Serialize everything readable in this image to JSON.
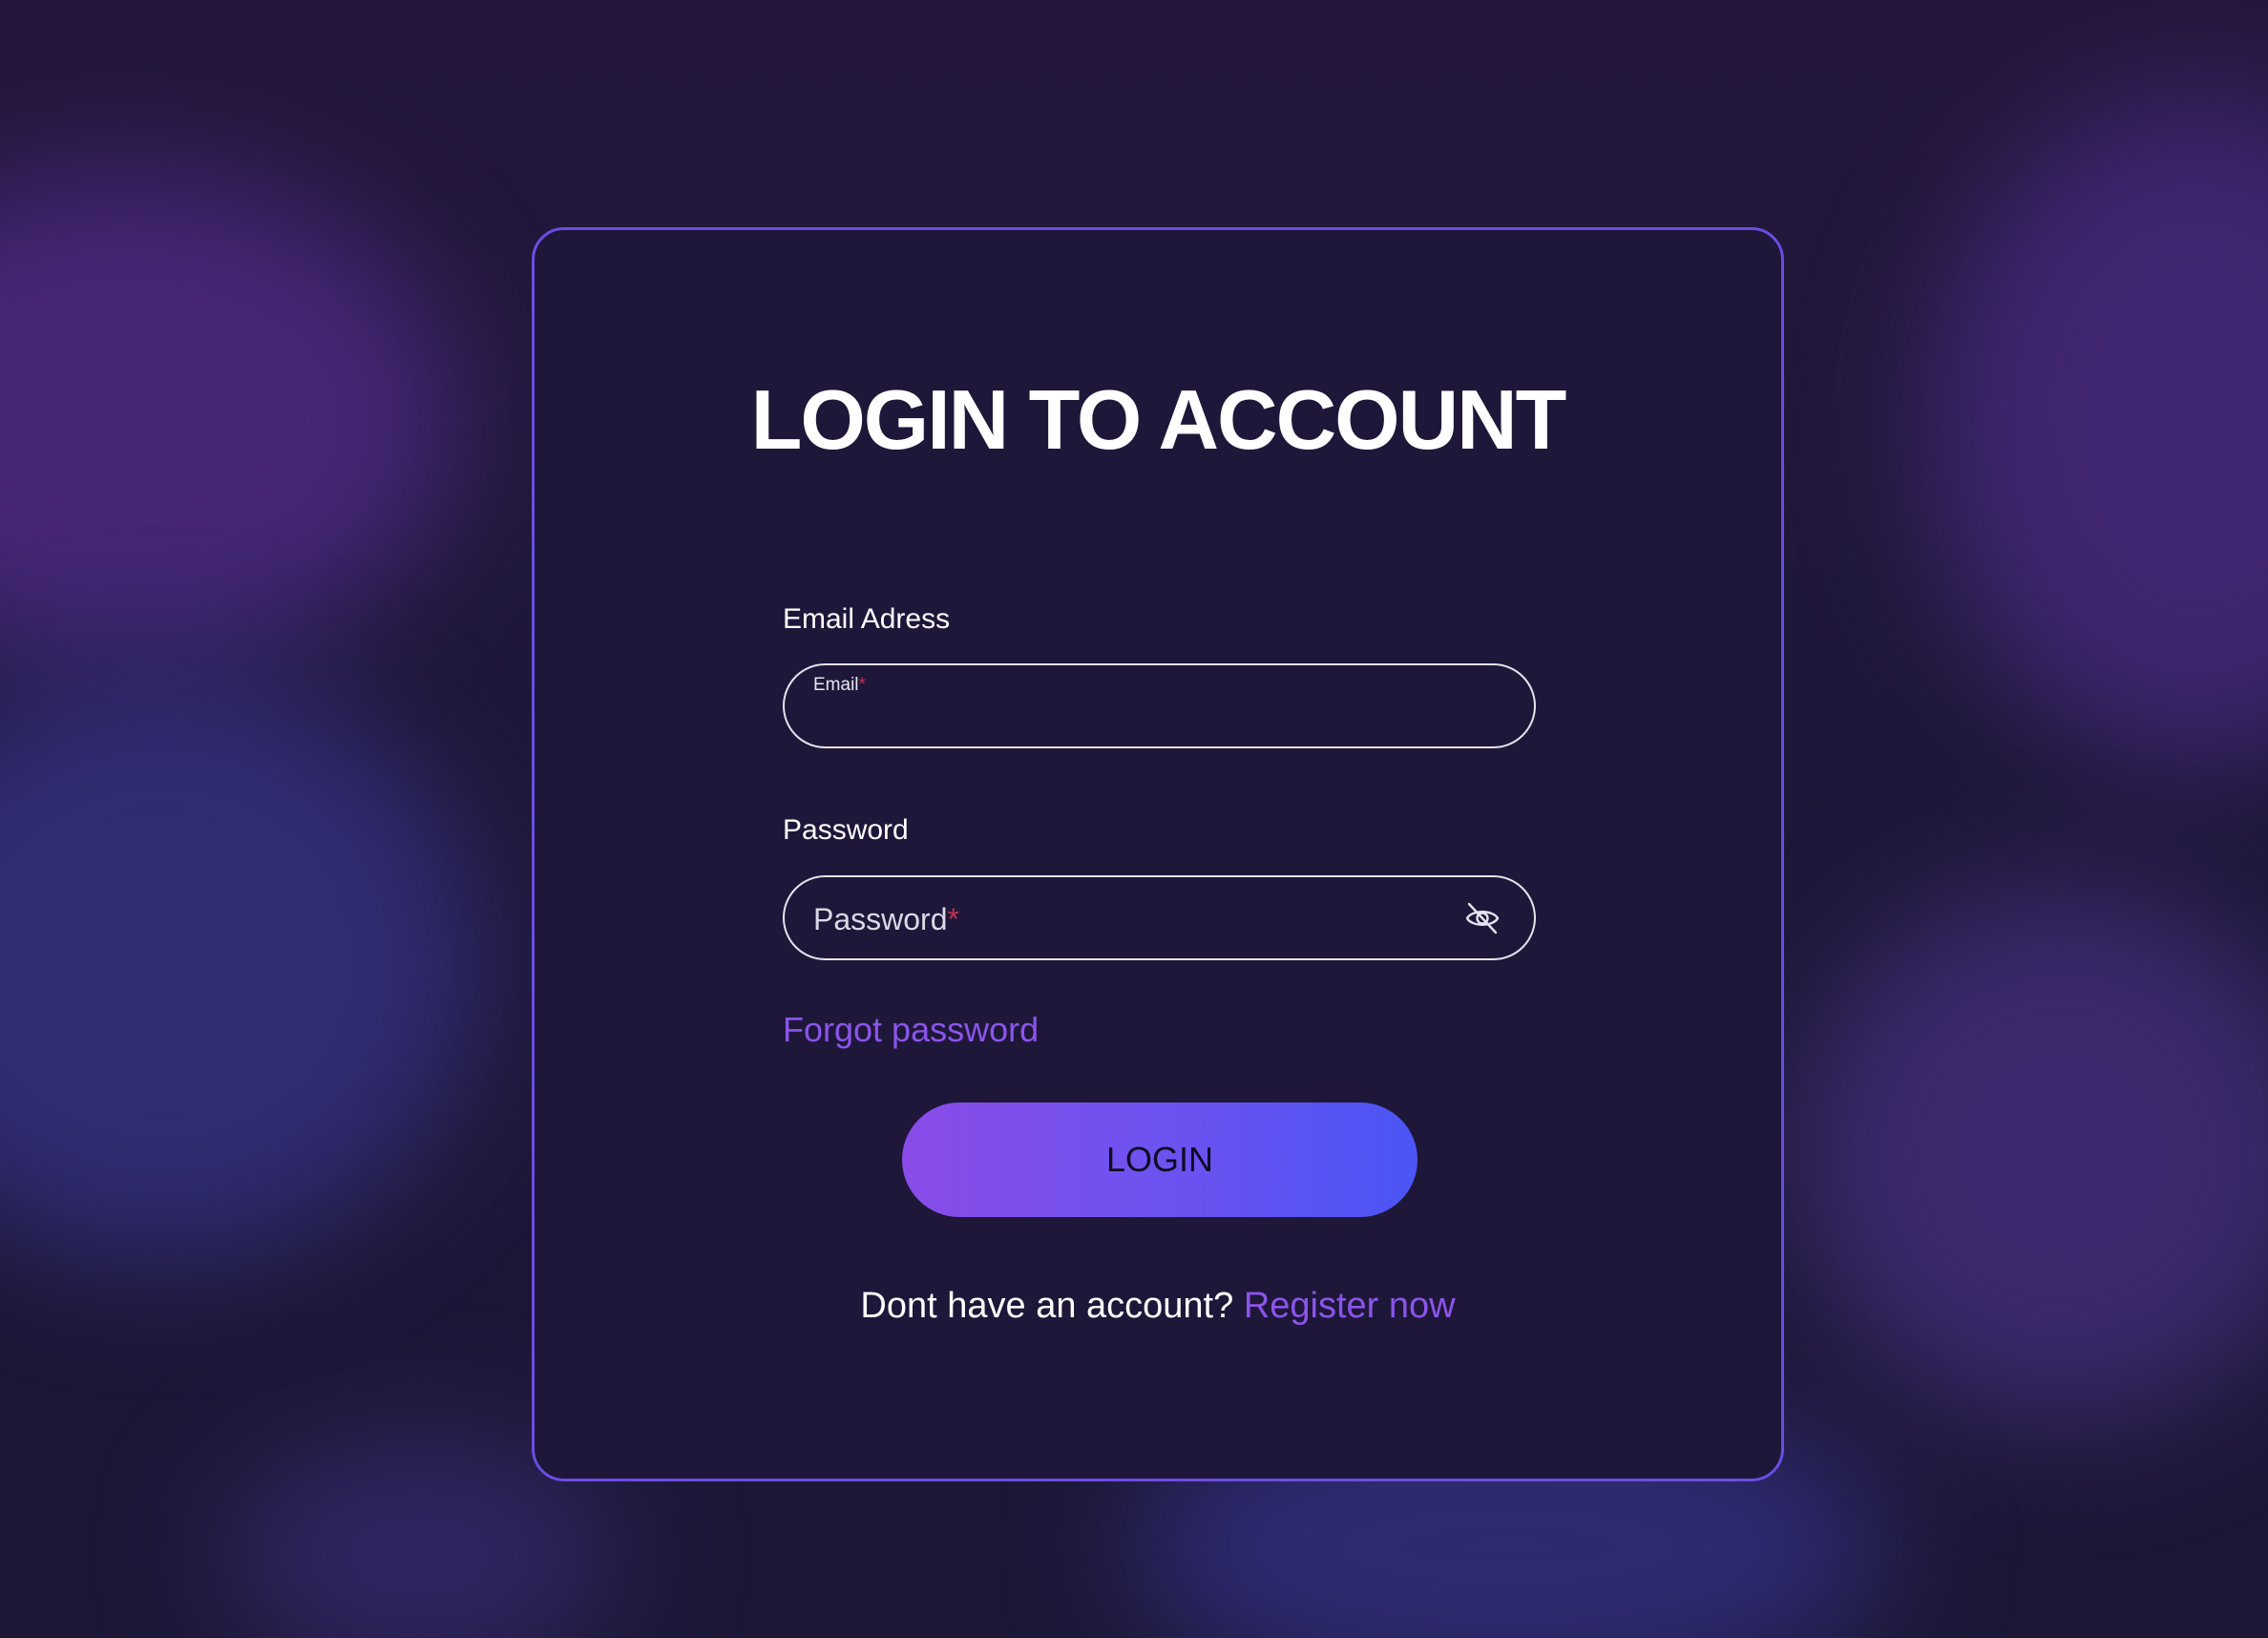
{
  "login_card": {
    "title": "LOGIN TO ACCOUNT",
    "email": {
      "label": "Email Adress",
      "placeholder": "Email",
      "required_mark": "*",
      "value": ""
    },
    "password": {
      "label": "Password",
      "placeholder": "Password",
      "required_mark": "*",
      "value": "",
      "visibility_icon": "eye-off-icon"
    },
    "forgot_password": "Forgot password",
    "login_button": "LOGIN",
    "signup_prompt": "Dont have an account?",
    "signup_link": "Register now"
  },
  "colors": {
    "background": "#1d1838",
    "card_background": "#1e173a",
    "card_border": "#6a4de2",
    "link": "#8b55ea",
    "required": "#c2304f",
    "button_gradient_start": "#8a4ce9",
    "button_gradient_end": "#4b55f5"
  }
}
